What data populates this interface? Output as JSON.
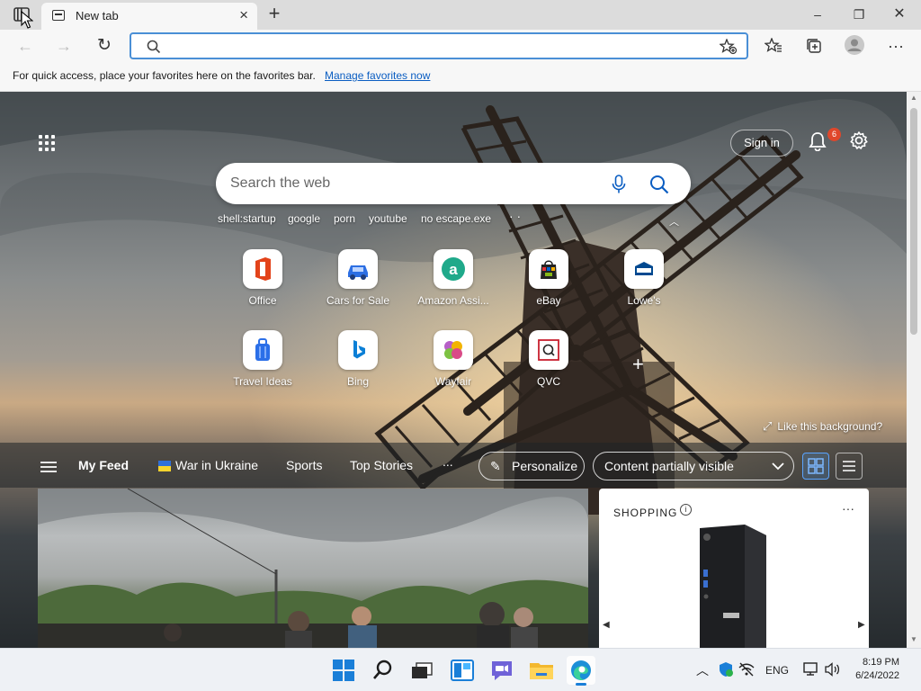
{
  "tab": {
    "title": "New tab"
  },
  "favorites_bar": {
    "message": "For quick access, place your favorites here on the favorites bar.",
    "link": "Manage favorites now"
  },
  "header": {
    "sign_in": "Sign in",
    "notification_count": "6"
  },
  "search": {
    "placeholder": "Search the web"
  },
  "quick_links": [
    "shell:startup",
    "google",
    "porn",
    "youtube",
    "no escape.exe"
  ],
  "tiles": [
    {
      "label": "Office"
    },
    {
      "label": "Cars for Sale"
    },
    {
      "label": "Amazon Assi..."
    },
    {
      "label": "eBay"
    },
    {
      "label": "Lowe's"
    },
    {
      "label": "Travel Ideas"
    },
    {
      "label": "Bing"
    },
    {
      "label": "Wayfair"
    },
    {
      "label": "QVC"
    }
  ],
  "like_background": "Like this background?",
  "feed": {
    "tabs": [
      "My Feed",
      "War in Ukraine",
      "Sports",
      "Top Stories"
    ],
    "more": "...",
    "personalize": "Personalize",
    "visibility": "Content partially visible"
  },
  "shopping": {
    "title": "SHOPPING"
  },
  "taskbar": {
    "language": "ENG",
    "time": "8:19 PM",
    "date": "6/24/2022"
  },
  "colors": {
    "accent": "#0a5dc2",
    "address_border": "#4a8fd6",
    "badge": "#e0472b"
  }
}
